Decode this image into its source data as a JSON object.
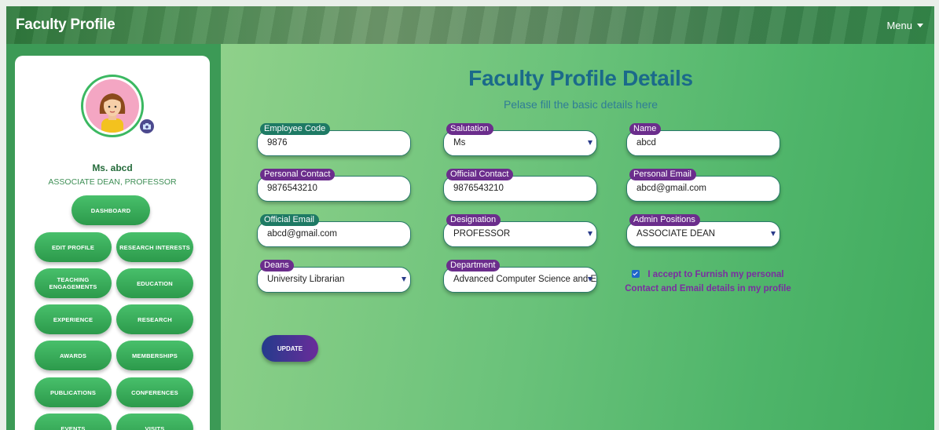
{
  "header": {
    "brand": "Faculty Profile",
    "menu_label": "Menu"
  },
  "profile": {
    "name": "Ms. abcd",
    "role": "ASSOCIATE DEAN, PROFESSOR",
    "avatar_icon": "female-avatar-icon",
    "camera_icon": "camera-icon"
  },
  "sidebar": {
    "dashboard": "DASHBOARD",
    "edit_profile": "EDIT PROFILE",
    "research_interests": "RESEARCH INTERESTS",
    "teaching_engagements": "TEACHING ENGAGEMENTS",
    "education": "EDUCATION",
    "experience": "EXPERIENCE",
    "research": "RESEARCH",
    "awards": "AWARDS",
    "memberships": "MEMBERSHIPS",
    "publications": "PUBLICATIONS",
    "conferences": "CONFERENCES",
    "events": "EVENTS",
    "visits": "VISITS"
  },
  "main": {
    "title": "Faculty Profile Details",
    "subtitle": "Pelase fill the basic details here",
    "fields": {
      "employee_code": {
        "label": "Employee Code",
        "value": "9876"
      },
      "salutation": {
        "label": "Salutation",
        "value": "Ms"
      },
      "name": {
        "label": "Name",
        "value": "abcd"
      },
      "personal_contact": {
        "label": "Personal Contact",
        "value": "9876543210"
      },
      "official_contact": {
        "label": "Official Contact",
        "value": "9876543210"
      },
      "personal_email": {
        "label": "Personal Email",
        "value": "abcd@gmail.com"
      },
      "official_email": {
        "label": "Official Email",
        "value": "abcd@gmail.com"
      },
      "designation": {
        "label": "Designation",
        "value": "PROFESSOR"
      },
      "admin_positions": {
        "label": "Admin Positions",
        "value": "ASSOCIATE DEAN"
      },
      "deans": {
        "label": "Deans",
        "value": "University Librarian"
      },
      "department": {
        "label": "Department",
        "value": "Advanced Computer Science and Er"
      }
    },
    "consent": "I accept to Furnish my personal Contact and Email details in my profile",
    "update_label": "UPDATE"
  },
  "colors": {
    "accent_green": "#3bb861",
    "title_blue": "#1b6a8a",
    "label_teal": "#1e7a64",
    "label_purple": "#6b2d8c",
    "consent_purple": "#7a2ea0"
  }
}
